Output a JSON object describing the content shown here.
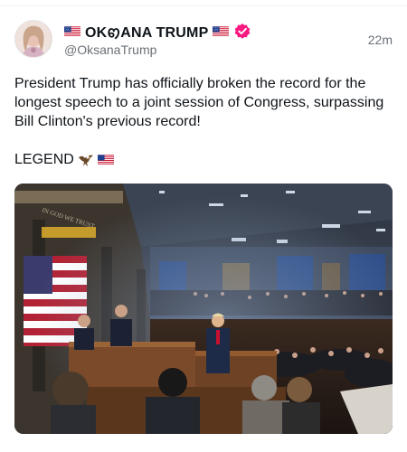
{
  "post": {
    "author": {
      "display_name": "OKꩅANA TRUMP",
      "handle": "@OksanaTrump",
      "verified": true,
      "flag_icon": "us-flag-icon",
      "avatar_icon": "avatar-photo"
    },
    "timestamp": "22m",
    "text": "President Trump has officially broken the record for the longest speech to a joint session of Congress, surpassing Bill Clinton's previous record!",
    "tag": "LEGEND",
    "tag_emojis": [
      "eagle-icon",
      "us-flag-icon"
    ],
    "media": {
      "type": "photo",
      "description_icon": "congress-chamber-photo",
      "caption_text": "IN GOD WE TRUST"
    }
  },
  "colors": {
    "text": "#0f1419",
    "secondary_text": "#6b7177",
    "verified_badge": "#f91880",
    "divider": "#eff1f3"
  }
}
